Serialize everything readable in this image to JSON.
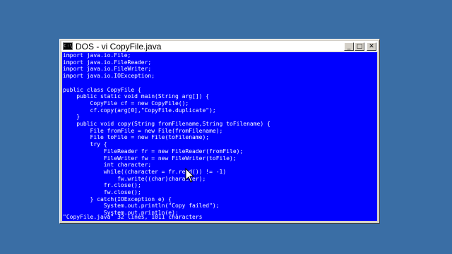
{
  "window": {
    "title": "DOS - vi CopyFile.java",
    "icon": "ms-dos-prompt-icon",
    "icon_text": "C:\\",
    "buttons": {
      "minimize": "_",
      "maximize": "□",
      "close": "✕"
    }
  },
  "editor": {
    "lines": [
      "import java.io.File;",
      "import java.io.FileReader;",
      "import java.io.FileWriter;",
      "import java.io.IOException;",
      "",
      "public class CopyFile {",
      "    public static void main(String arg[]) {",
      "        CopyFile cf = new CopyFile();",
      "        cf.copy(arg[0],\"CopyFile.duplicate\");",
      "    }",
      "    public void copy(String fromFilename,String toFilename) {",
      "        File fromFile = new File(fromFilename);",
      "        File toFile = new File(toFilename);",
      "        try {",
      "            FileReader fr = new FileReader(fromFile);",
      "            FileWriter fw = new FileWriter(toFile);",
      "            int character;",
      "            while((character = fr.read()) != -1)",
      "                fw.write((char)character);",
      "            fr.close();",
      "            fw.close();",
      "        } catch(IOException e) {",
      "            System.out.println(\"Copy failed\");",
      "            System.out.println(e);"
    ],
    "status": "\"CopyFile.java\" 32 lines, 1011 characters"
  },
  "colors": {
    "desktop": "#3a6ea5",
    "console_bg": "#0000ff",
    "console_fg": "#ffffff"
  }
}
